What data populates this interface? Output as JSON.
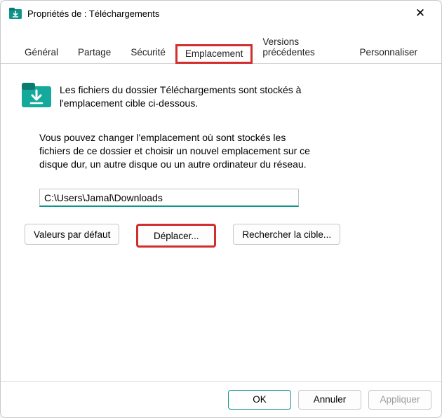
{
  "title": "Propriétés de : Téléchargements",
  "tabs": {
    "general": "Général",
    "partage": "Partage",
    "securite": "Sécurité",
    "emplacement": "Emplacement",
    "versions": "Versions précédentes",
    "personnaliser": "Personnaliser"
  },
  "main_desc": "Les fichiers du dossier Téléchargements sont stockés à l'emplacement cible ci-dessous.",
  "sub_desc": "Vous pouvez changer l'emplacement où sont stockés les fichiers de ce dossier et choisir un nouvel emplacement sur ce disque dur, un autre disque ou un autre ordinateur du réseau.",
  "path": "C:\\Users\\Jamal\\Downloads",
  "buttons": {
    "restore": "Valeurs par défaut",
    "move": "Déplacer...",
    "find": "Rechercher la cible..."
  },
  "footer": {
    "ok": "OK",
    "cancel": "Annuler",
    "apply": "Appliquer"
  }
}
